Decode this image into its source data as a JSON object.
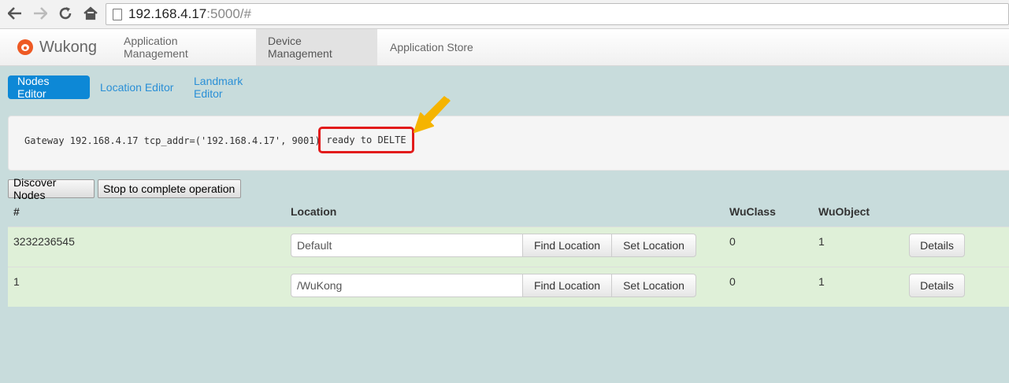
{
  "browser": {
    "url_host": "192.168.4.17",
    "url_path": ":5000/#",
    "back_icon": "back-arrow-icon",
    "forward_icon": "forward-arrow-icon",
    "reload_icon": "reload-icon",
    "home_icon": "home-icon"
  },
  "navbar": {
    "brand": "Wukong",
    "items": [
      {
        "label": "Application Management",
        "active": false
      },
      {
        "label": "Device Management",
        "active": true
      },
      {
        "label": "Application Store",
        "active": false
      }
    ]
  },
  "pills": [
    {
      "label": "Nodes Editor",
      "active": true
    },
    {
      "label": "Location Editor",
      "active": false
    },
    {
      "label": "Landmark Editor",
      "active": false
    }
  ],
  "status": {
    "text": "Gateway 192.168.4.17 tcp_addr=('192.168.4.17', 9001)",
    "highlight": "ready to DELTE",
    "highlight_color": "#e21b1b",
    "arrow_color": "#f5b400"
  },
  "actions": {
    "discover": "Discover Nodes",
    "stop": "Stop to complete operation"
  },
  "table": {
    "headers": {
      "id": "#",
      "location": "Location",
      "wuclass": "WuClass",
      "wuobject": "WuObject"
    },
    "rows": [
      {
        "id": "3232236545",
        "location": "Default",
        "find": "Find Location",
        "set": "Set Location",
        "wuclass": "0",
        "wuobject": "1",
        "details": "Details"
      },
      {
        "id": "1",
        "location": "/WuKong",
        "find": "Find Location",
        "set": "Set Location",
        "wuclass": "0",
        "wuobject": "1",
        "details": "Details"
      }
    ]
  }
}
